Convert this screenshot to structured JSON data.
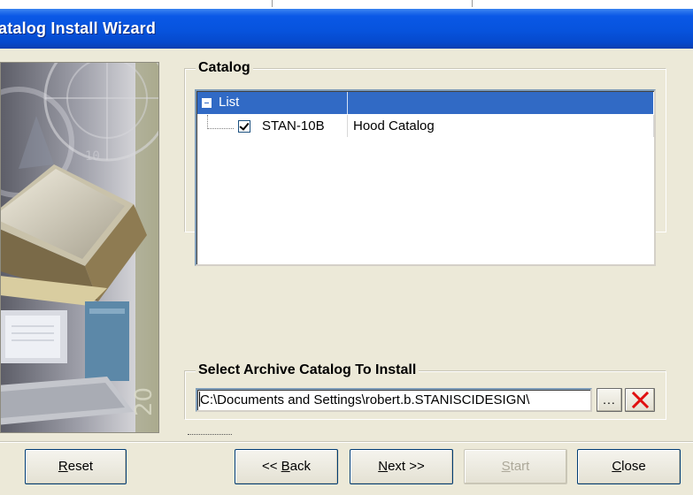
{
  "window": {
    "title": "atalog Install Wizard"
  },
  "catalog_group": {
    "label": "Catalog",
    "tree": {
      "header_label": "List",
      "rows": [
        {
          "code": "STAN-10B",
          "description": "Hood Catalog",
          "checked": true
        }
      ]
    }
  },
  "archive_group": {
    "label": "Select Archive Catalog To Install",
    "path_value": "C:\\Documents and Settings\\robert.b.STANISCIDESIGN\\",
    "browse_label": "...",
    "clear_icon": "red-x-icon"
  },
  "buttons": {
    "reset": {
      "mnemonic": "R",
      "rest": "eset"
    },
    "back": {
      "prefix": "<< ",
      "mnemonic": "B",
      "rest": "ack"
    },
    "next": {
      "mnemonic": "N",
      "rest": "ext >>"
    },
    "start": {
      "mnemonic": "S",
      "rest": "tart",
      "enabled": false
    },
    "close": {
      "mnemonic": "C",
      "rest": "lose"
    }
  },
  "colors": {
    "titlebar": "#0753dd",
    "selection": "#316ac5",
    "window_bg": "#ece9d8",
    "clear_icon": "#e01010"
  }
}
